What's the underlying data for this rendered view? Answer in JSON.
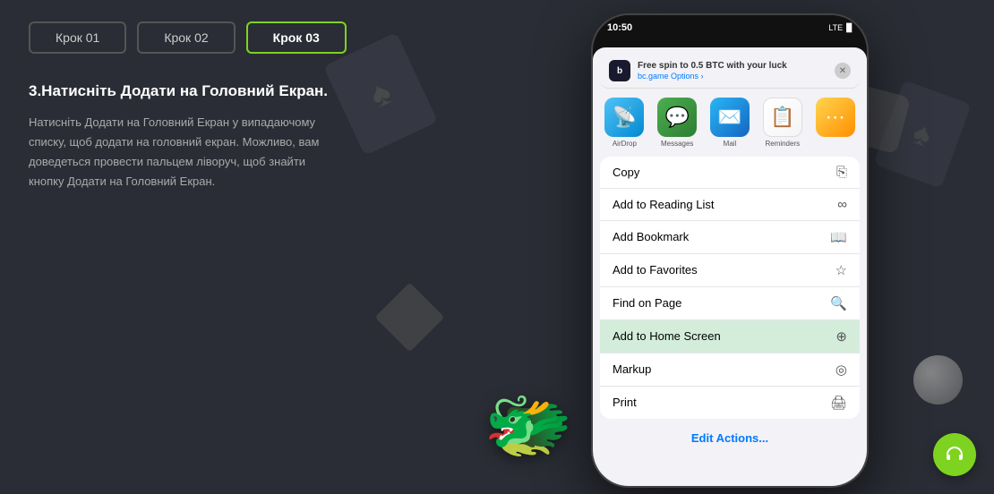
{
  "steps": {
    "tab1": {
      "label": "Крок 01",
      "active": false
    },
    "tab2": {
      "label": "Крок 02",
      "active": false
    },
    "tab3": {
      "label": "Крок 03",
      "active": true
    }
  },
  "left": {
    "heading": "3.Натисніть Додати на Головний Екран.",
    "description": "Натисніть Додати на Головний Екран у випадаючому списку, щоб додати на головний екран. Можливо, вам доведеться провести пальцем ліворуч, щоб знайти кнопку Додати на Головний Екран."
  },
  "phone": {
    "time": "10:50",
    "status": "LTE",
    "notification": {
      "title": "Free spin to 0.5 BTC with your luck",
      "sub": "bc.game  Options  ›"
    },
    "appIcons": [
      {
        "label": "AirDrop",
        "icon": "📡"
      },
      {
        "label": "Messages",
        "icon": "💬"
      },
      {
        "label": "Mail",
        "icon": "✉️"
      },
      {
        "label": "Reminders",
        "icon": "📋"
      }
    ],
    "menuItems": [
      {
        "label": "Copy",
        "icon": "⎘",
        "highlighted": false
      },
      {
        "label": "Add to Reading List",
        "icon": "∞",
        "highlighted": false
      },
      {
        "label": "Add Bookmark",
        "icon": "📖",
        "highlighted": false
      },
      {
        "label": "Add to Favorites",
        "icon": "☆",
        "highlighted": false
      },
      {
        "label": "Find on Page",
        "icon": "🔍",
        "highlighted": false
      },
      {
        "label": "Add to Home Screen",
        "icon": "⊕",
        "highlighted": true
      },
      {
        "label": "Markup",
        "icon": "◎",
        "highlighted": false
      },
      {
        "label": "Print",
        "icon": "🖨",
        "highlighted": false
      }
    ],
    "editActions": "Edit Actions..."
  },
  "support": {
    "label": "Support"
  }
}
